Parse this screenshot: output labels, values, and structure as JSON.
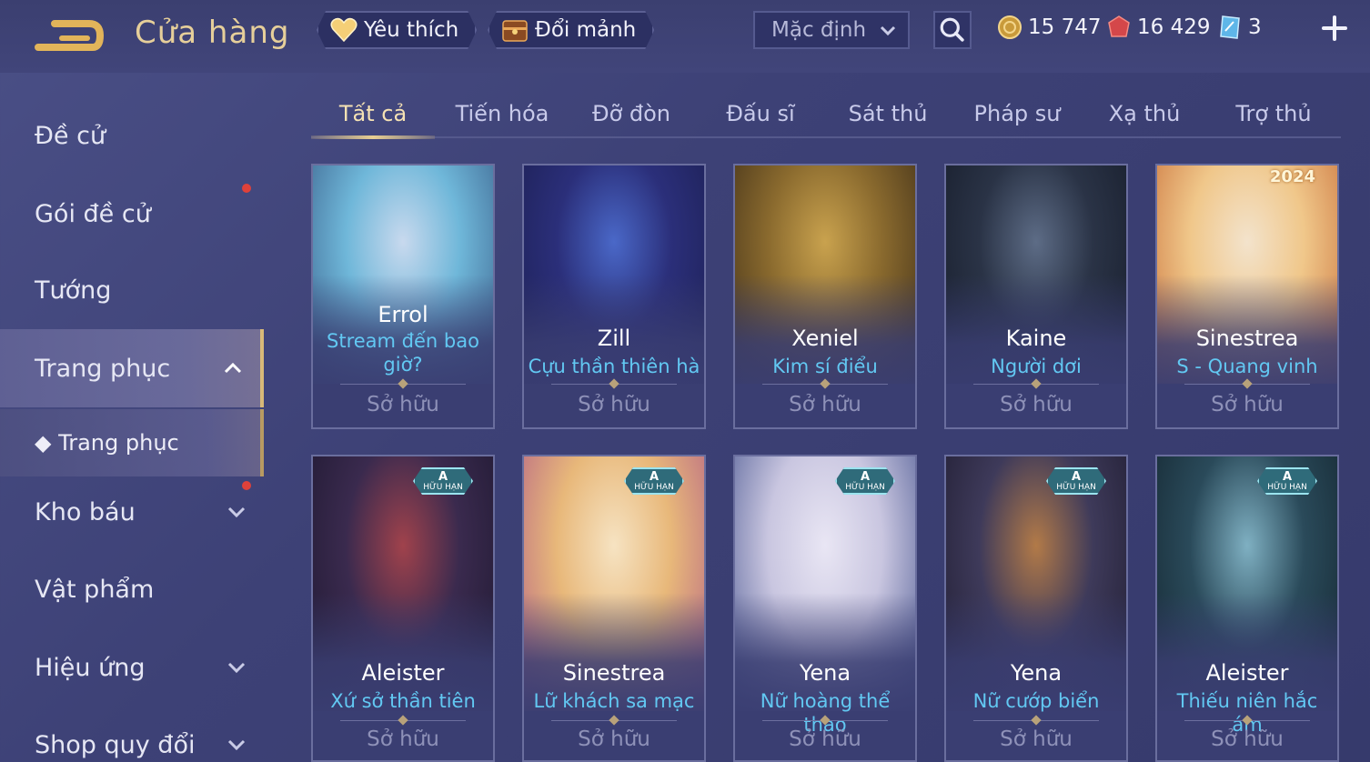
{
  "header": {
    "title": "Cửa hàng",
    "favorites_label": "Yêu thích",
    "exchange_label": "Đổi mảnh",
    "sort_value": "Mặc định",
    "currencies": [
      {
        "icon": "gold-coin-icon",
        "value": "15 747"
      },
      {
        "icon": "red-gem-icon",
        "value": "16 429"
      },
      {
        "icon": "blue-ticket-icon",
        "value": "3"
      }
    ]
  },
  "sidebar": {
    "items": [
      {
        "label": "Đề cử"
      },
      {
        "label": "Gói đề cử"
      },
      {
        "label": "Tướng"
      },
      {
        "label": "Trang phục"
      },
      {
        "label": "Kho báu"
      },
      {
        "label": "Vật phẩm"
      },
      {
        "label": "Hiệu ứng"
      },
      {
        "label": "Shop quy đổi"
      }
    ],
    "sub_item": "◆ Trang phục"
  },
  "tabs": [
    "Tất cả",
    "Tiến hóa",
    "Đỡ đòn",
    "Đấu sĩ",
    "Sát thủ",
    "Pháp sư",
    "Xạ thủ",
    "Trợ thủ"
  ],
  "badge": {
    "rank": "A",
    "text": "HỮU HẠN"
  },
  "year_tag": "2024",
  "cards": [
    {
      "hero": "Errol",
      "skin": "Stream đến bao giờ?",
      "status": "Sở hữu",
      "colors": [
        "#6fb7d9",
        "#c8d9ee",
        "#3a5f8a"
      ]
    },
    {
      "hero": "Zill",
      "skin": "Cựu thần thiên hà",
      "status": "Sở hữu",
      "colors": [
        "#2b2f7a",
        "#4a68c8",
        "#1c1f52"
      ]
    },
    {
      "hero": "Xeniel",
      "skin": "Kim sí điểu",
      "status": "Sở hữu",
      "colors": [
        "#8a6a2e",
        "#c9a24e",
        "#3e2e18"
      ]
    },
    {
      "hero": "Kaine",
      "skin": "Người dơi",
      "status": "Sở hữu",
      "colors": [
        "#2a3346",
        "#5d6c86",
        "#161c2a"
      ]
    },
    {
      "hero": "Sinestrea",
      "skin": "S - Quang vinh",
      "status": "Sở hữu",
      "colors": [
        "#f0c78a",
        "#f3e3cc",
        "#c9703a"
      ]
    },
    {
      "hero": "Aleister",
      "skin": "Xứ sở thần tiên",
      "status": "Sở hữu",
      "colors": [
        "#3a2a4e",
        "#a0424c",
        "#1e1830"
      ]
    },
    {
      "hero": "Sinestrea",
      "skin": "Lữ khách sa mạc",
      "status": "Sở hữu",
      "colors": [
        "#e8b87a",
        "#f6e3c2",
        "#b35f86"
      ]
    },
    {
      "hero": "Yena",
      "skin": "Nữ hoàng thể thao",
      "status": "Sở hữu",
      "colors": [
        "#c9c6e0",
        "#e9e6f4",
        "#4d5a92"
      ]
    },
    {
      "hero": "Yena",
      "skin": "Nữ cướp biển",
      "status": "Sở hữu",
      "colors": [
        "#3e3a5a",
        "#b27a48",
        "#1f1c30"
      ]
    },
    {
      "hero": "Aleister",
      "skin": "Thiếu niên hắc ám",
      "status": "Sở hữu",
      "colors": [
        "#2a4a5a",
        "#7fb0c2",
        "#142630"
      ]
    }
  ]
}
